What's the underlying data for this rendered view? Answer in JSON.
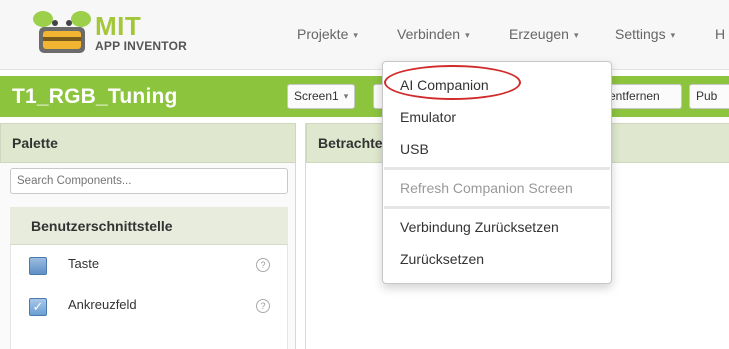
{
  "app": {
    "logo_title": "MIT",
    "logo_subtitle": "APP INVENTOR"
  },
  "nav": [
    {
      "label": "Projekte"
    },
    {
      "label": "Verbinden"
    },
    {
      "label": "Erzeugen"
    },
    {
      "label": "Settings"
    },
    {
      "label": "H"
    }
  ],
  "project": {
    "name": "T1_RGB_Tuning",
    "screen_select": "Screen1",
    "remove_screen_partial": "n entfernen",
    "publish_partial": "Pub"
  },
  "palette": {
    "title": "Palette",
    "search_placeholder": "Search Components...",
    "category": "Benutzerschnittstelle",
    "components": [
      {
        "label": "Taste",
        "icon": "button-icon"
      },
      {
        "label": "Ankreuzfeld",
        "icon": "checkbox-icon"
      }
    ],
    "help_glyph": "?"
  },
  "viewer": {
    "title": "Betrachte"
  },
  "menu": {
    "items": [
      {
        "label": "AI Companion",
        "enabled": true,
        "highlighted": true
      },
      {
        "label": "Emulator",
        "enabled": true
      },
      {
        "label": "USB",
        "enabled": true
      },
      {
        "label": "Refresh Companion Screen",
        "enabled": false
      },
      {
        "label": "Verbindung Zurücksetzen",
        "enabled": true
      },
      {
        "label": "Zurücksetzen",
        "enabled": true
      }
    ]
  },
  "colors": {
    "accent_green": "#8dc43e",
    "highlight_red": "#d12a2a"
  }
}
